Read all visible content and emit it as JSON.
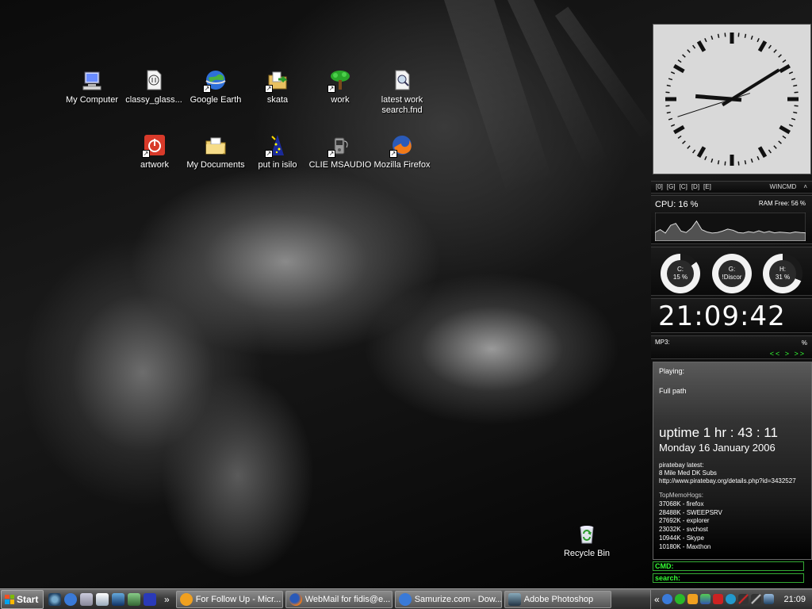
{
  "desktop": {
    "icons_row1": [
      {
        "label": "My Computer",
        "icon": "computer-icon"
      },
      {
        "label": "classy_glass...",
        "icon": "document-icon"
      },
      {
        "label": "Google Earth",
        "icon": "globe-icon"
      },
      {
        "label": "skata",
        "icon": "folder-icon"
      },
      {
        "label": "work",
        "icon": "tree-icon"
      },
      {
        "label": "latest work search.fnd",
        "icon": "search-file-icon"
      }
    ],
    "icons_row2": [
      {
        "label": "artwork",
        "icon": "power-icon"
      },
      {
        "label": "My Documents",
        "icon": "folder-icon"
      },
      {
        "label": "put in isilo",
        "icon": "wizard-icon"
      },
      {
        "label": "CLIE MSAUDIO",
        "icon": "device-icon"
      },
      {
        "label": "Mozilla Firefox",
        "icon": "firefox-icon"
      }
    ],
    "recycle_bin": "Recycle Bin"
  },
  "sidebar": {
    "drives": [
      "[0]",
      "[G]",
      "[C]",
      "[D]",
      "[E]"
    ],
    "wincmd": "WINCMD",
    "wincmd_arrow": "˄",
    "cpu_label": "CPU: 16 %",
    "ram_label": "RAM Free: 56 %",
    "cpu_graph": [
      30,
      40,
      28,
      55,
      62,
      35,
      30,
      45,
      70,
      40,
      32,
      28,
      30,
      35,
      42,
      38,
      30,
      28,
      33,
      30,
      36,
      30,
      34,
      29,
      31,
      30,
      28,
      32,
      30,
      29
    ],
    "disks": [
      {
        "name": "C:",
        "value": "15 %",
        "percent": 15
      },
      {
        "name": "G:",
        "value": "!Discor",
        "percent": 0
      },
      {
        "name": "H:",
        "value": "31 %",
        "percent": 31
      }
    ],
    "digital_time": "21:09:42",
    "mp3_label": "MP3:",
    "mp3_percent": "%",
    "mp3_controls": "<< > >>",
    "playing_label": "Playing:",
    "full_path_label": "Full path",
    "uptime": "uptime 1 hr : 43 : 11",
    "date": "Monday 16 January 2006",
    "piratebay_title": "piratebay latest:",
    "piratebay_item": "8 Mile Med DK Subs",
    "piratebay_url": "http://www.piratebay.org/details.php?id=3432527",
    "hogs_title": "TopMemoHogs:",
    "hogs": [
      "37068K - firefox",
      "28488K - SWEEPSRV",
      "27692K - explorer",
      "23032K - svchost",
      "10944K - Skype",
      "10180K - Maxthon"
    ],
    "cmd_label": "CMD:",
    "search_label": "search:"
  },
  "clock": {
    "hour": 9,
    "minute": 9,
    "second": 42
  },
  "taskbar": {
    "start": "Start",
    "tasks": [
      {
        "label": "For Follow Up - Micr...",
        "icon": "outlook-icon"
      },
      {
        "label": "WebMail for fidis@e...",
        "icon": "firefox-icon"
      },
      {
        "label": "Samurize.com - Dow...",
        "icon": "maxthon-icon"
      },
      {
        "label": "Adobe Photoshop",
        "icon": "photoshop-icon"
      }
    ],
    "more_glyph": "»",
    "tray_expand": "«",
    "time": "21:09"
  }
}
